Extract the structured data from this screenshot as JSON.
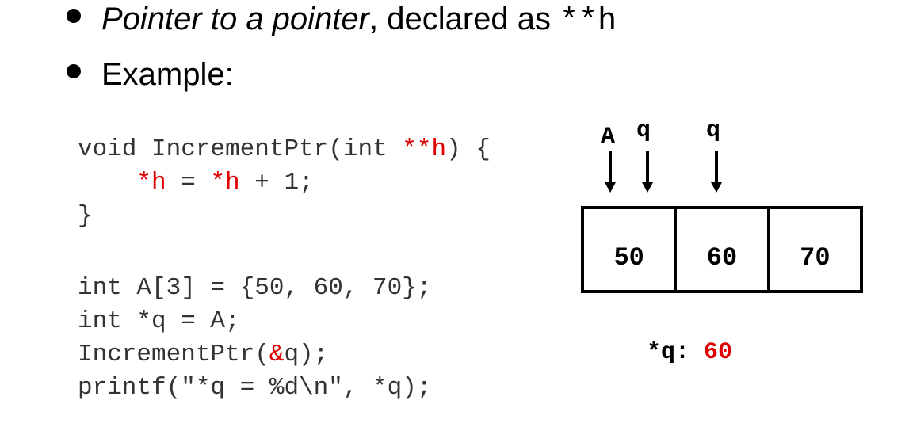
{
  "bullets": {
    "first": {
      "italic": "Pointer to a pointer",
      "rest": ", declared as ",
      "code": "**h"
    },
    "second": "Example:"
  },
  "code": {
    "line1_a": "void IncrementPtr(int ",
    "line1_b": "**h",
    "line1_c": ") {",
    "line2_indent": "    ",
    "line2_a": "*h",
    "line2_b": " = ",
    "line2_c": "*h",
    "line2_d": " + 1;",
    "line3": "}",
    "line4": "int A[3] = {50, 60, 70};",
    "line5": "int *q = A;",
    "line6_a": "IncrementPtr(",
    "line6_b": "&",
    "line6_c": "q);",
    "line7": "printf(\"*q = %d\\n\", *q);"
  },
  "diagram": {
    "labels": [
      "A",
      "q",
      "q"
    ],
    "cells": [
      "50",
      "60",
      "70"
    ],
    "result_label": "*q:",
    "result_value": "60",
    "accent": "#e00000"
  }
}
